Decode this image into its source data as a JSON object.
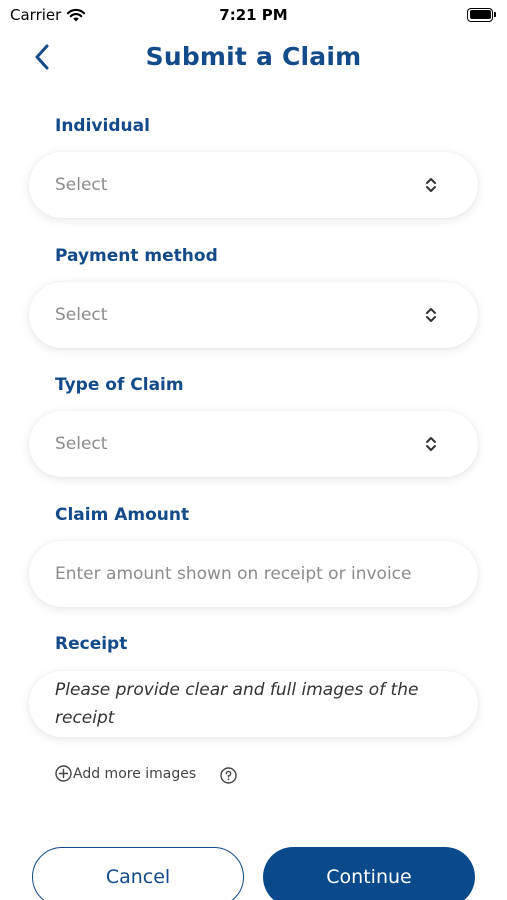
{
  "status_bar": {
    "carrier": "Carrier",
    "time": "7:21 PM"
  },
  "header": {
    "title": "Submit a Claim",
    "back_icon": "chevron-left-icon"
  },
  "form": {
    "individual": {
      "label": "Individual",
      "value": "Select"
    },
    "payment_method": {
      "label": "Payment method",
      "value": "Select"
    },
    "claim_type": {
      "label": "Type of Claim",
      "value": "Select"
    },
    "claim_amount": {
      "label": "Claim Amount",
      "placeholder": "Enter amount shown on receipt or invoice"
    },
    "receipt": {
      "label": "Receipt",
      "hint": "Please provide clear and full images of the receipt"
    },
    "add_images_label": "Add more images"
  },
  "buttons": {
    "cancel": "Cancel",
    "continue": "Continue"
  },
  "colors": {
    "brand": "#124a8a",
    "primary_button": "#0a4a8c",
    "placeholder": "#8b8b8b"
  }
}
